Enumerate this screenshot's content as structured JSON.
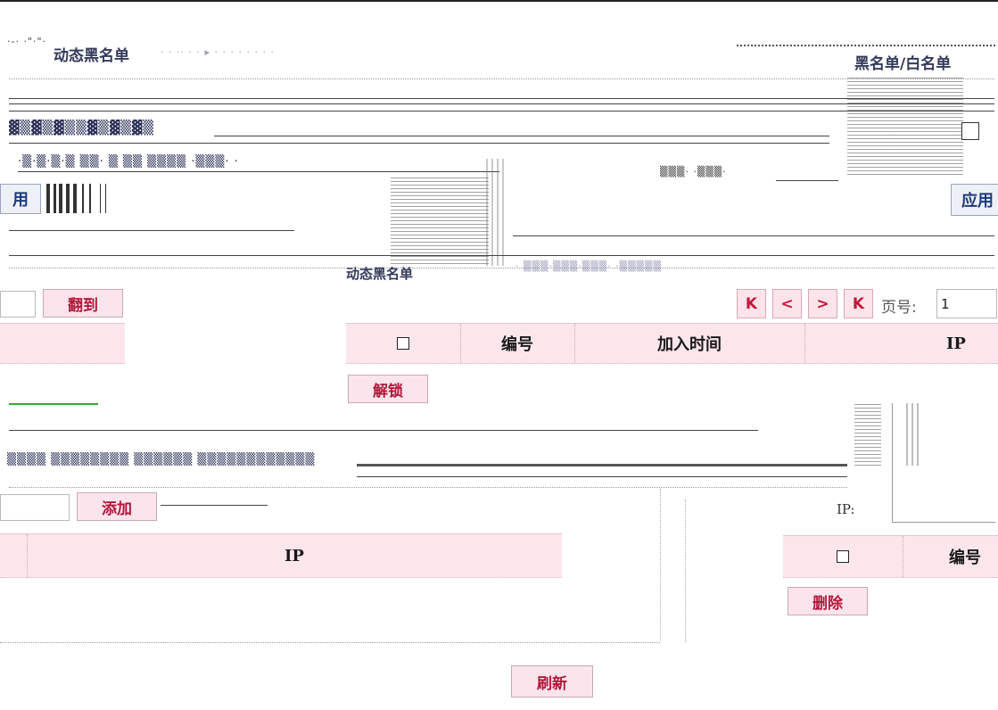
{
  "panels": {
    "top_title": "动态黑名单",
    "top_right_title": "黑名单/白名单",
    "mid_title": "动态黑名单"
  },
  "left_panel": {
    "jump_button": "翻到",
    "add_button": "添加",
    "ip_column": "IP"
  },
  "right_panel": {
    "apply_button": "应用",
    "page_label": "页号:",
    "page_value": "1",
    "columns": [
      "编号",
      "加入时间",
      "IP"
    ],
    "unlock_button": "解锁",
    "ip_label": "IP:",
    "number_column": "编号",
    "delete_button": "删除"
  },
  "pager": {
    "first_icon": "K",
    "prev_icon": "<",
    "next_icon": ">",
    "last_icon": "K"
  },
  "footer": {
    "refresh_button": "刷新"
  },
  "partial_text": {
    "left_cut": "用"
  }
}
